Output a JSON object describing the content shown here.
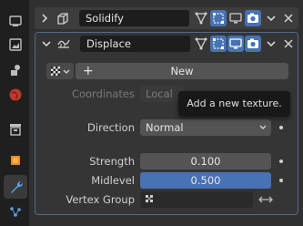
{
  "modifiers": [
    {
      "name": "Solidify",
      "icon": "solidify-modifier-icon",
      "expanded": false
    },
    {
      "name": "Displace",
      "icon": "displace-modifier-icon",
      "expanded": true
    }
  ],
  "displace": {
    "texture_button": {
      "label": "New",
      "plus": "+"
    },
    "coordinates": {
      "label": "Coordinates",
      "value": "Local"
    },
    "direction": {
      "label": "Direction",
      "value": "Normal"
    },
    "strength": {
      "label": "Strength",
      "value": "0.100"
    },
    "midlevel": {
      "label": "Midlevel",
      "value": "0.500"
    },
    "vertex_group": {
      "label": "Vertex Group",
      "value": ""
    }
  },
  "tooltip": {
    "text": "Add a new texture."
  },
  "colors": {
    "accent": "#4772b3",
    "panel_bg": "#303030",
    "field": "#545454",
    "active_border": "#4f6a8f"
  },
  "sidebar_icons": [
    "render-icon",
    "output-icon",
    "view-layer-icon",
    "world-icon",
    "collection-icon",
    "object-icon",
    "modifier-wrench-icon",
    "particles-icon"
  ]
}
